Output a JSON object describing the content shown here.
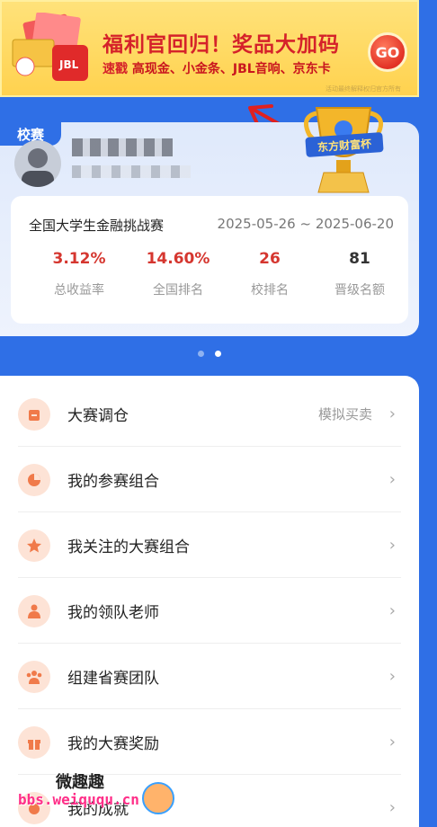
{
  "banner": {
    "title": "福利官回归！奖品大加码",
    "sub_prefix": "速戳 ",
    "sub_prizes": "高现金、小金条、JBL音响、京东卡",
    "go": "GO",
    "fine_print": "活动最终解释权归官方所有"
  },
  "card": {
    "badge": "校赛",
    "trophy_label": "东方财富杯",
    "contest_name": "全国大学生金融挑战赛",
    "contest_dates": "2025-05-26 ~ 2025-06-20",
    "stats": [
      {
        "value": "3.12%",
        "label": "总收益率"
      },
      {
        "value": "14.60%",
        "label": "全国排名"
      },
      {
        "value": "26",
        "label": "校排名"
      },
      {
        "value": "81",
        "label": "晋级名额"
      }
    ],
    "carousel_active_index": 1
  },
  "menu": {
    "items": [
      {
        "label": "大赛调仓",
        "extra": "模拟买卖",
        "icon": "briefcase-icon"
      },
      {
        "label": "我的参赛组合",
        "extra": "",
        "icon": "pie-chart-icon"
      },
      {
        "label": "我关注的大赛组合",
        "extra": "",
        "icon": "star-icon"
      },
      {
        "label": "我的领队老师",
        "extra": "",
        "icon": "teacher-icon"
      },
      {
        "label": "组建省赛团队",
        "extra": "",
        "icon": "team-icon"
      },
      {
        "label": "我的大赛奖励",
        "extra": "",
        "icon": "gift-icon"
      },
      {
        "label": "我的成就",
        "extra": "",
        "icon": "medal-icon"
      }
    ],
    "chevron": "›"
  },
  "watermark": {
    "cn": "微趣趣",
    "url": "bbs.weiququ.cn"
  },
  "colors": {
    "page_bg": "#2f6fe6",
    "accent_red": "#d5362f",
    "icon_bg": "#fde3d6",
    "icon_fg": "#f07a4a"
  }
}
